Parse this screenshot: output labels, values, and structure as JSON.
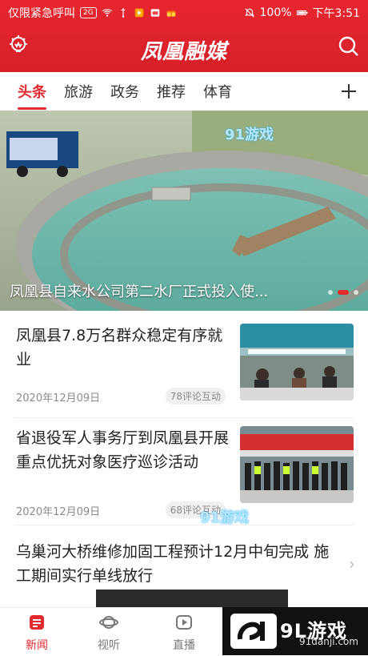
{
  "status": {
    "left_text": "仅限紧急呼叫",
    "right_battery": "100%",
    "right_time": "下午3:51",
    "badge_2g": "2G"
  },
  "header": {
    "brand": "凤凰融媒"
  },
  "tabs": [
    {
      "label": "头条",
      "active": true
    },
    {
      "label": "旅游",
      "active": false
    },
    {
      "label": "政务",
      "active": false
    },
    {
      "label": "推荐",
      "active": false
    },
    {
      "label": "体育",
      "active": false
    }
  ],
  "hero": {
    "title": "凤凰县自来水公司第二水厂正式投入使...",
    "watermark": "91游戏",
    "slide_index": 1,
    "slide_count": 3
  },
  "news": [
    {
      "title": "凤凰县7.8万名群众稳定有序就业",
      "date": "2020年12月09日",
      "badge": "78评论互动"
    },
    {
      "title": "省退役军人事务厅到凤凰县开展重点优抚对象医疗巡诊活动",
      "date": "2020年12月09日",
      "badge": "68评论互动"
    },
    {
      "title": "乌巢河大桥维修加固工程预计12月中旬完成 施工期间实行单线放行"
    }
  ],
  "bottom_nav": [
    {
      "label": "新闻",
      "active": true
    },
    {
      "label": "视听",
      "active": false
    },
    {
      "label": "直播",
      "active": false
    }
  ],
  "promo": {
    "brand": "9L游戏",
    "domain": "91danji.com"
  },
  "colors": {
    "accent": "#e22a2f",
    "header": "#d61f28"
  }
}
